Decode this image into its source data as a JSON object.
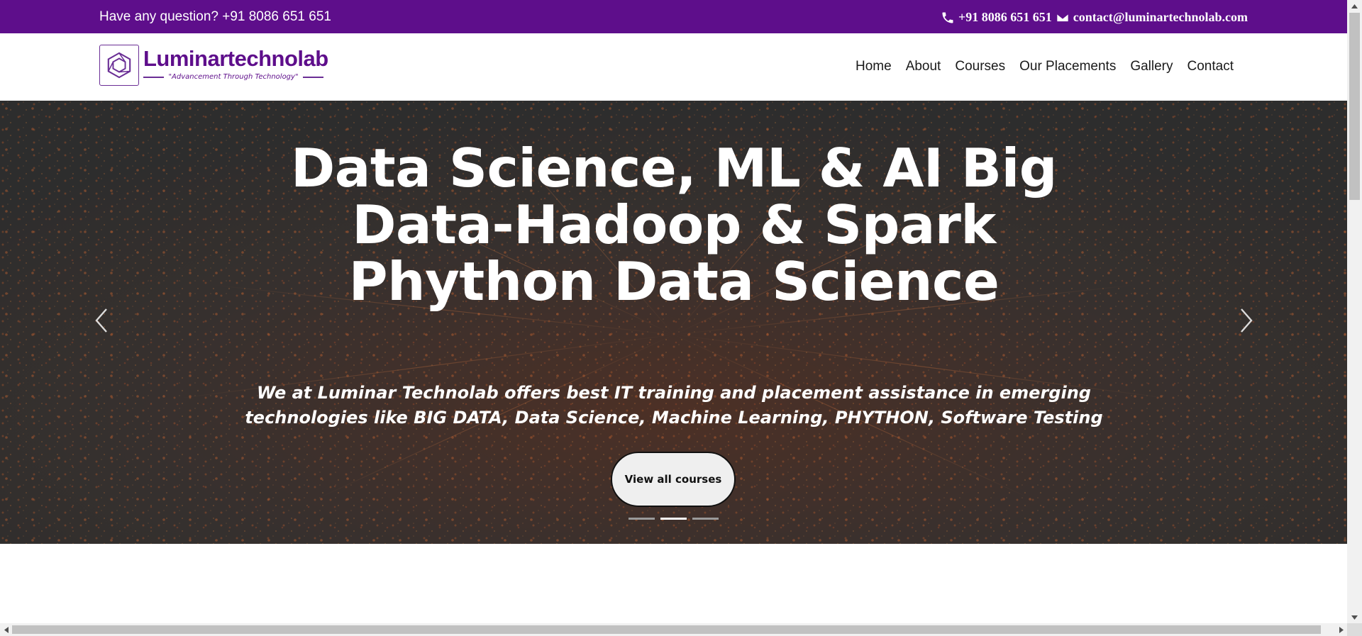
{
  "topbar": {
    "question": "Have any question? +91 8086 651 651",
    "phone": "+91 8086 651 651",
    "email": "contact@luminartechnolab.com",
    "bg_color": "#5e0e8b"
  },
  "brand": {
    "name": "Luminartechnolab",
    "tagline": "\"Advancement Through Technology\"",
    "color": "#5e0e8b"
  },
  "nav": {
    "items": [
      {
        "label": "Home"
      },
      {
        "label": "About"
      },
      {
        "label": "Courses"
      },
      {
        "label": "Our Placements"
      },
      {
        "label": "Gallery"
      },
      {
        "label": "Contact"
      }
    ]
  },
  "hero": {
    "title": "Data Science, ML & AI Big Data-Hadoop & Spark Phython Data Science",
    "subtitle": "We at Luminar Technolab offers best IT training and placement assistance in emerging technologies like BIG DATA, Data Science, Machine Learning, PHYTHON, Software Testing",
    "cta_label": "View all courses",
    "slide_count": 3,
    "active_slide": 2,
    "prev_icon": "chevron-left-icon",
    "next_icon": "chevron-right-icon"
  }
}
